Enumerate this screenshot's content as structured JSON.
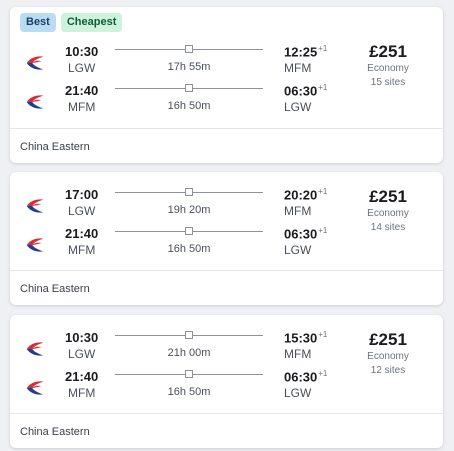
{
  "results": [
    {
      "badges": [
        "Best",
        "Cheapest"
      ],
      "legs": [
        {
          "dep_time": "10:30",
          "dep_code": "LGW",
          "duration": "17h 55m",
          "arr_time": "12:25",
          "arr_offset": "+1",
          "arr_code": "MFM"
        },
        {
          "dep_time": "21:40",
          "dep_code": "MFM",
          "duration": "16h 50m",
          "arr_time": "06:30",
          "arr_offset": "+1",
          "arr_code": "LGW"
        }
      ],
      "price": "£251",
      "cabin": "Economy",
      "sites": "15 sites",
      "airline": "China Eastern"
    },
    {
      "badges": [],
      "legs": [
        {
          "dep_time": "17:00",
          "dep_code": "LGW",
          "duration": "19h 20m",
          "arr_time": "20:20",
          "arr_offset": "+1",
          "arr_code": "MFM"
        },
        {
          "dep_time": "21:40",
          "dep_code": "MFM",
          "duration": "16h 50m",
          "arr_time": "06:30",
          "arr_offset": "+1",
          "arr_code": "LGW"
        }
      ],
      "price": "£251",
      "cabin": "Economy",
      "sites": "14 sites",
      "airline": "China Eastern"
    },
    {
      "badges": [],
      "legs": [
        {
          "dep_time": "10:30",
          "dep_code": "LGW",
          "duration": "21h 00m",
          "arr_time": "15:30",
          "arr_offset": "+1",
          "arr_code": "MFM"
        },
        {
          "dep_time": "21:40",
          "dep_code": "MFM",
          "duration": "16h 50m",
          "arr_time": "06:30",
          "arr_offset": "+1",
          "arr_code": "LGW"
        }
      ],
      "price": "£251",
      "cabin": "Economy",
      "sites": "12 sites",
      "airline": "China Eastern"
    }
  ],
  "icons": {
    "airline_logo": "china-eastern-logo-icon",
    "stop_marker": "stop-marker-icon"
  },
  "colors": {
    "best_badge": "#b9dcf2",
    "cheapest_badge": "#cdf3dc",
    "logo_red": "#d32f3a",
    "logo_blue": "#1f3f8f"
  }
}
